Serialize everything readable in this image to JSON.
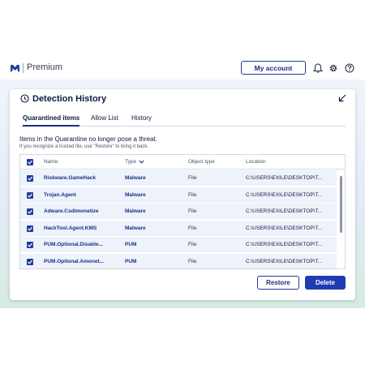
{
  "header": {
    "brand": "Premium",
    "account_button": "My account",
    "icons": [
      "bell-icon",
      "gear-icon",
      "help-icon"
    ]
  },
  "panel": {
    "title": "Detection History",
    "tabs": [
      {
        "label": "Quarantined items",
        "active": true
      },
      {
        "label": "Allow List",
        "active": false
      },
      {
        "label": "History",
        "active": false
      }
    ],
    "message": "Items in the Quarantine no longer pose a threat.",
    "submessage": "If you recognize a trusted file, use \"Restore\" to bring it back."
  },
  "table": {
    "columns": {
      "name": "Name",
      "type": "Type",
      "object_type": "Object type",
      "location": "Location"
    },
    "rows": [
      {
        "name": "Riskware.GameHack",
        "type": "Malware",
        "object_type": "File",
        "location": "C:\\USERS\\EXILE\\DESKTOP\\T...",
        "checked": true
      },
      {
        "name": "Trojan.Agent",
        "type": "Malware",
        "object_type": "File",
        "location": "C:\\USERS\\EXILE\\DESKTOP\\T...",
        "checked": true
      },
      {
        "name": "Adware.Csdimonetize",
        "type": "Malware",
        "object_type": "File",
        "location": "C:\\USERS\\EXILE\\DESKTOP\\T...",
        "checked": true
      },
      {
        "name": "HackTool.Agent.KMS",
        "type": "Malware",
        "object_type": "File",
        "location": "C:\\USERS\\EXILE\\DESKTOP\\T...",
        "checked": true
      },
      {
        "name": "PUM.Optional.Disable...",
        "type": "PUM",
        "object_type": "File",
        "location": "C:\\USERS\\EXILE\\DESKTOP\\T...",
        "checked": true
      },
      {
        "name": "PUM.Optional.Amonet...",
        "type": "PUM",
        "object_type": "File",
        "location": "C:\\USERS\\EXILE\\DESKTOP\\T...",
        "checked": true
      }
    ]
  },
  "actions": {
    "restore": "Restore",
    "delete": "Delete"
  },
  "colors": {
    "accent": "#1f3cb4",
    "row_bg": "#eef2fa",
    "text": "#0d1b3e"
  }
}
